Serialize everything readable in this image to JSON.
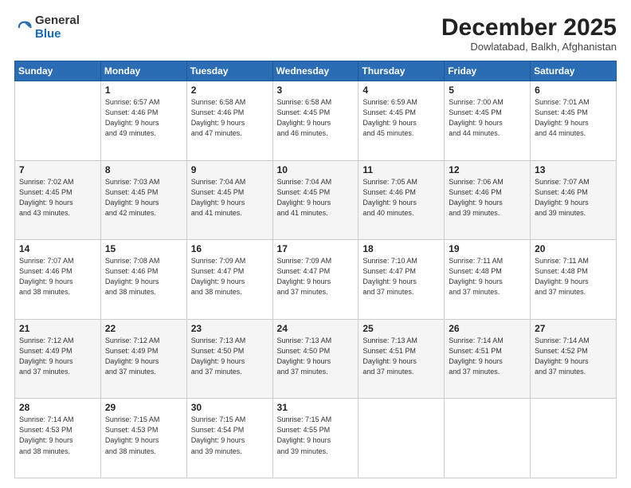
{
  "logo": {
    "general": "General",
    "blue": "Blue"
  },
  "header": {
    "month_title": "December 2025",
    "subtitle": "Dowlatabad, Balkh, Afghanistan"
  },
  "days_of_week": [
    "Sunday",
    "Monday",
    "Tuesday",
    "Wednesday",
    "Thursday",
    "Friday",
    "Saturday"
  ],
  "weeks": [
    [
      {
        "day": "",
        "text": ""
      },
      {
        "day": "1",
        "text": "Sunrise: 6:57 AM\nSunset: 4:46 PM\nDaylight: 9 hours\nand 49 minutes."
      },
      {
        "day": "2",
        "text": "Sunrise: 6:58 AM\nSunset: 4:46 PM\nDaylight: 9 hours\nand 47 minutes."
      },
      {
        "day": "3",
        "text": "Sunrise: 6:58 AM\nSunset: 4:45 PM\nDaylight: 9 hours\nand 46 minutes."
      },
      {
        "day": "4",
        "text": "Sunrise: 6:59 AM\nSunset: 4:45 PM\nDaylight: 9 hours\nand 45 minutes."
      },
      {
        "day": "5",
        "text": "Sunrise: 7:00 AM\nSunset: 4:45 PM\nDaylight: 9 hours\nand 44 minutes."
      },
      {
        "day": "6",
        "text": "Sunrise: 7:01 AM\nSunset: 4:45 PM\nDaylight: 9 hours\nand 44 minutes."
      }
    ],
    [
      {
        "day": "7",
        "text": "Sunrise: 7:02 AM\nSunset: 4:45 PM\nDaylight: 9 hours\nand 43 minutes."
      },
      {
        "day": "8",
        "text": "Sunrise: 7:03 AM\nSunset: 4:45 PM\nDaylight: 9 hours\nand 42 minutes."
      },
      {
        "day": "9",
        "text": "Sunrise: 7:04 AM\nSunset: 4:45 PM\nDaylight: 9 hours\nand 41 minutes."
      },
      {
        "day": "10",
        "text": "Sunrise: 7:04 AM\nSunset: 4:45 PM\nDaylight: 9 hours\nand 41 minutes."
      },
      {
        "day": "11",
        "text": "Sunrise: 7:05 AM\nSunset: 4:46 PM\nDaylight: 9 hours\nand 40 minutes."
      },
      {
        "day": "12",
        "text": "Sunrise: 7:06 AM\nSunset: 4:46 PM\nDaylight: 9 hours\nand 39 minutes."
      },
      {
        "day": "13",
        "text": "Sunrise: 7:07 AM\nSunset: 4:46 PM\nDaylight: 9 hours\nand 39 minutes."
      }
    ],
    [
      {
        "day": "14",
        "text": "Sunrise: 7:07 AM\nSunset: 4:46 PM\nDaylight: 9 hours\nand 38 minutes."
      },
      {
        "day": "15",
        "text": "Sunrise: 7:08 AM\nSunset: 4:46 PM\nDaylight: 9 hours\nand 38 minutes."
      },
      {
        "day": "16",
        "text": "Sunrise: 7:09 AM\nSunset: 4:47 PM\nDaylight: 9 hours\nand 38 minutes."
      },
      {
        "day": "17",
        "text": "Sunrise: 7:09 AM\nSunset: 4:47 PM\nDaylight: 9 hours\nand 37 minutes."
      },
      {
        "day": "18",
        "text": "Sunrise: 7:10 AM\nSunset: 4:47 PM\nDaylight: 9 hours\nand 37 minutes."
      },
      {
        "day": "19",
        "text": "Sunrise: 7:11 AM\nSunset: 4:48 PM\nDaylight: 9 hours\nand 37 minutes."
      },
      {
        "day": "20",
        "text": "Sunrise: 7:11 AM\nSunset: 4:48 PM\nDaylight: 9 hours\nand 37 minutes."
      }
    ],
    [
      {
        "day": "21",
        "text": "Sunrise: 7:12 AM\nSunset: 4:49 PM\nDaylight: 9 hours\nand 37 minutes."
      },
      {
        "day": "22",
        "text": "Sunrise: 7:12 AM\nSunset: 4:49 PM\nDaylight: 9 hours\nand 37 minutes."
      },
      {
        "day": "23",
        "text": "Sunrise: 7:13 AM\nSunset: 4:50 PM\nDaylight: 9 hours\nand 37 minutes."
      },
      {
        "day": "24",
        "text": "Sunrise: 7:13 AM\nSunset: 4:50 PM\nDaylight: 9 hours\nand 37 minutes."
      },
      {
        "day": "25",
        "text": "Sunrise: 7:13 AM\nSunset: 4:51 PM\nDaylight: 9 hours\nand 37 minutes."
      },
      {
        "day": "26",
        "text": "Sunrise: 7:14 AM\nSunset: 4:51 PM\nDaylight: 9 hours\nand 37 minutes."
      },
      {
        "day": "27",
        "text": "Sunrise: 7:14 AM\nSunset: 4:52 PM\nDaylight: 9 hours\nand 37 minutes."
      }
    ],
    [
      {
        "day": "28",
        "text": "Sunrise: 7:14 AM\nSunset: 4:53 PM\nDaylight: 9 hours\nand 38 minutes."
      },
      {
        "day": "29",
        "text": "Sunrise: 7:15 AM\nSunset: 4:53 PM\nDaylight: 9 hours\nand 38 minutes."
      },
      {
        "day": "30",
        "text": "Sunrise: 7:15 AM\nSunset: 4:54 PM\nDaylight: 9 hours\nand 39 minutes."
      },
      {
        "day": "31",
        "text": "Sunrise: 7:15 AM\nSunset: 4:55 PM\nDaylight: 9 hours\nand 39 minutes."
      },
      {
        "day": "",
        "text": ""
      },
      {
        "day": "",
        "text": ""
      },
      {
        "day": "",
        "text": ""
      }
    ]
  ]
}
